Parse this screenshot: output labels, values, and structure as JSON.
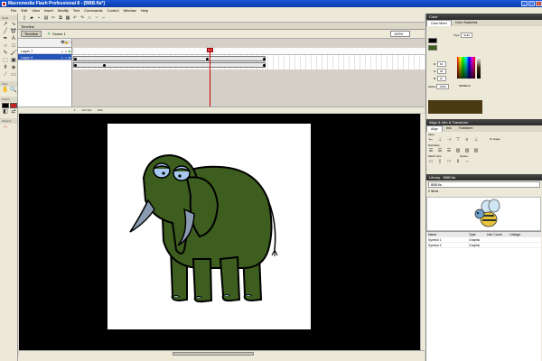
{
  "app": {
    "title": "Macromedia Flash Professional 8 - [BBB.fla*]",
    "window_buttons": [
      "_",
      "□",
      "×"
    ]
  },
  "menu": [
    "File",
    "Edit",
    "View",
    "Insert",
    "Modify",
    "Text",
    "Commands",
    "Control",
    "Window",
    "Help"
  ],
  "tools": {
    "tools_label": "Tools",
    "view_label": "View",
    "colors_label": "Colors",
    "options_label": "Options",
    "icons": [
      "arrow-icon",
      "subselect-icon",
      "line-icon",
      "lasso-icon",
      "pen-icon",
      "text-icon",
      "oval-icon",
      "rect-icon",
      "pencil-icon",
      "brush-icon",
      "freetransform-icon",
      "filltransform-icon",
      "inkbottle-icon",
      "paintbucket-icon",
      "eyedropper-icon",
      "eraser-icon"
    ],
    "stroke_color": "#000000",
    "fill_color": "#d02020"
  },
  "timeline": {
    "tab_label": "Timeline",
    "timeline_button": "Timeline",
    "scene_label": "Scene 1",
    "zoom": "100%",
    "layers": [
      {
        "name": "Layer 7"
      },
      {
        "name": "Layer 4"
      }
    ],
    "status": [
      "1",
      "12.0 fps",
      "0.0s"
    ]
  },
  "stage": {
    "background": "#000000",
    "artboard": "#ffffff",
    "elephant_body": "#3d5e1f",
    "elephant_eye": "#a8c8f0"
  },
  "color_panel": {
    "title": "Color",
    "tabs": [
      "Color Mixer",
      "Color Swatches"
    ],
    "type_label": "Type:",
    "type_value": "Solid",
    "r_label": "R:",
    "r_value": "61",
    "g_label": "G:",
    "g_value": "94",
    "b_label": "B:",
    "b_value": "31",
    "alpha_label": "Alpha:",
    "alpha_value": "100%",
    "hex_value": "#3D5E1F"
  },
  "align_panel": {
    "title": "Align & Info & Transform",
    "tabs": [
      "Align",
      "Info",
      "Transform"
    ],
    "align_label": "Align:",
    "distribute_label": "Distribute:",
    "match_label": "Match size:",
    "space_label": "Space:",
    "to_stage_label": "To stage:"
  },
  "library_panel": {
    "title": "Library - BBB.fla",
    "file": "BBB.fla",
    "count": "2 items",
    "columns": [
      "Name",
      "Type",
      "Use Count",
      "Linkage"
    ],
    "items": [
      {
        "name": "Symbol 1",
        "type": "Graphic"
      },
      {
        "name": "Symbol 2",
        "type": "Graphic"
      }
    ]
  }
}
